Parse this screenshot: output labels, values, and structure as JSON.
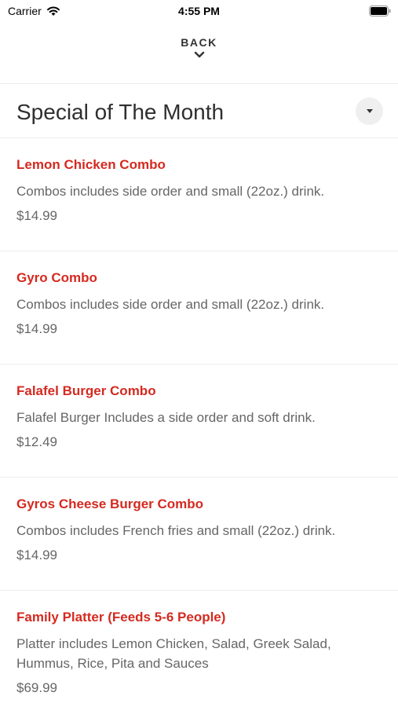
{
  "status_bar": {
    "carrier": "Carrier",
    "time": "4:55 PM",
    "wifi_icon": "wifi-icon",
    "battery_icon": "battery-icon"
  },
  "nav": {
    "back_label": "BACK",
    "chevron_icon": "chevron-down-icon"
  },
  "section": {
    "title": "Special of The Month",
    "dropdown_icon": "caret-down-icon"
  },
  "items": [
    {
      "name": "Lemon Chicken Combo",
      "description": "Combos includes side order and small (22oz.) drink.",
      "price": "$14.99"
    },
    {
      "name": "Gyro Combo",
      "description": "Combos includes side order and small (22oz.) drink.",
      "price": "$14.99"
    },
    {
      "name": "Falafel Burger Combo",
      "description": "Falafel Burger Includes a side order and soft drink.",
      "price": "$12.49"
    },
    {
      "name": "Gyros Cheese Burger Combo",
      "description": "Combos includes French fries and small (22oz.) drink.",
      "price": "$14.99"
    },
    {
      "name": "Family Platter (Feeds 5-6 People)",
      "description": "Platter includes Lemon Chicken, Salad, Greek Salad, Hummus, Rice, Pita and Sauces",
      "price": "$69.99"
    }
  ],
  "colors": {
    "item_name": "#d42a20",
    "text_muted": "#666666",
    "title": "#2f2f2f"
  }
}
